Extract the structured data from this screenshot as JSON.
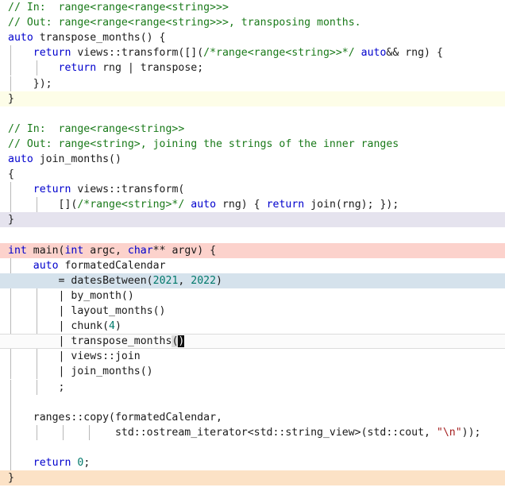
{
  "editor": {
    "language": "cpp",
    "total_lines": 32,
    "colors": {
      "background": "#ffffff",
      "default_text": "#1a1a1a",
      "comment": "#1a7a1a",
      "keyword": "#0000cd",
      "number": "#00796b",
      "string": "#a52020",
      "indent_guide": "#b8b8b8",
      "highlight_yellow": "#fdfde8",
      "highlight_lavender": "#e5e3ee",
      "highlight_pink": "#fcd2cc",
      "highlight_blue": "#d5e2ec",
      "highlight_peach": "#fce2c6",
      "cursor_line": "#fbfbfb",
      "bracket_match": "#dcdcdc",
      "block_cursor": "#101010"
    },
    "cursor": {
      "line_index": 23,
      "column": 27,
      "character": ")",
      "matching_bracket_character": "("
    },
    "lines": [
      {
        "index": 0,
        "highlight": "none",
        "indent_guides": 0,
        "plain": "// In:  range<range<range<string>>>",
        "tokens": [
          {
            "t": "comment",
            "s": "// In:  range<range<range<string>>>"
          }
        ]
      },
      {
        "index": 1,
        "highlight": "none",
        "indent_guides": 0,
        "plain": "// Out: range<range<range<string>>>, transposing months.",
        "tokens": [
          {
            "t": "comment",
            "s": "// Out: range<range<range<string>>>, transposing months."
          }
        ]
      },
      {
        "index": 2,
        "highlight": "none",
        "indent_guides": 0,
        "plain": "auto transpose_months() {",
        "tokens": [
          {
            "t": "keyword",
            "s": "auto"
          },
          {
            "t": "plain",
            "s": " transpose_months() {"
          }
        ]
      },
      {
        "index": 3,
        "highlight": "none",
        "indent_guides": 1,
        "plain": "    return views::transform([](/*range<range<string>>*/ auto&& rng) {",
        "tokens": [
          {
            "t": "plain",
            "s": "    "
          },
          {
            "t": "keyword",
            "s": "return"
          },
          {
            "t": "plain",
            "s": " views::transform([]("
          },
          {
            "t": "comment",
            "s": "/*range<range<string>>*/"
          },
          {
            "t": "plain",
            "s": " "
          },
          {
            "t": "keyword",
            "s": "auto"
          },
          {
            "t": "plain",
            "s": "&& rng) {"
          }
        ]
      },
      {
        "index": 4,
        "highlight": "none",
        "indent_guides": 2,
        "plain": "        return rng | transpose;",
        "tokens": [
          {
            "t": "plain",
            "s": "        "
          },
          {
            "t": "keyword",
            "s": "return"
          },
          {
            "t": "plain",
            "s": " rng | transpose;"
          }
        ]
      },
      {
        "index": 5,
        "highlight": "none",
        "indent_guides": 1,
        "plain": "    });",
        "tokens": [
          {
            "t": "plain",
            "s": "    });"
          }
        ]
      },
      {
        "index": 6,
        "highlight": "yellow",
        "indent_guides": 0,
        "plain": "}",
        "tokens": [
          {
            "t": "plain",
            "s": "}"
          }
        ]
      },
      {
        "index": 7,
        "highlight": "none",
        "indent_guides": 0,
        "plain": "",
        "tokens": []
      },
      {
        "index": 8,
        "highlight": "none",
        "indent_guides": 0,
        "plain": "// In:  range<range<string>>",
        "tokens": [
          {
            "t": "comment",
            "s": "// In:  range<range<string>>"
          }
        ]
      },
      {
        "index": 9,
        "highlight": "none",
        "indent_guides": 0,
        "plain": "// Out: range<string>, joining the strings of the inner ranges",
        "tokens": [
          {
            "t": "comment",
            "s": "// Out: range<string>, joining the strings of the inner ranges"
          }
        ]
      },
      {
        "index": 10,
        "highlight": "none",
        "indent_guides": 0,
        "plain": "auto join_months()",
        "tokens": [
          {
            "t": "keyword",
            "s": "auto"
          },
          {
            "t": "plain",
            "s": " join_months()"
          }
        ]
      },
      {
        "index": 11,
        "highlight": "none",
        "indent_guides": 0,
        "plain": "{",
        "tokens": [
          {
            "t": "plain",
            "s": "{"
          }
        ]
      },
      {
        "index": 12,
        "highlight": "none",
        "indent_guides": 1,
        "plain": "    return views::transform(",
        "tokens": [
          {
            "t": "plain",
            "s": "    "
          },
          {
            "t": "keyword",
            "s": "return"
          },
          {
            "t": "plain",
            "s": " views::transform("
          }
        ]
      },
      {
        "index": 13,
        "highlight": "none",
        "indent_guides": 2,
        "plain": "        [](/*range<string>*/ auto rng) { return join(rng); });",
        "tokens": [
          {
            "t": "plain",
            "s": "        []("
          },
          {
            "t": "comment",
            "s": "/*range<string>*/"
          },
          {
            "t": "plain",
            "s": " "
          },
          {
            "t": "keyword",
            "s": "auto"
          },
          {
            "t": "plain",
            "s": " rng) { "
          },
          {
            "t": "keyword",
            "s": "return"
          },
          {
            "t": "plain",
            "s": " join(rng); });"
          }
        ]
      },
      {
        "index": 14,
        "highlight": "lavender",
        "indent_guides": 0,
        "plain": "}",
        "tokens": [
          {
            "t": "plain",
            "s": "}"
          }
        ]
      },
      {
        "index": 15,
        "highlight": "none",
        "indent_guides": 0,
        "plain": "",
        "tokens": []
      },
      {
        "index": 16,
        "highlight": "pink",
        "indent_guides": 0,
        "plain": "int main(int argc, char** argv) {",
        "tokens": [
          {
            "t": "keyword",
            "s": "int"
          },
          {
            "t": "plain",
            "s": " main("
          },
          {
            "t": "keyword",
            "s": "int"
          },
          {
            "t": "plain",
            "s": " argc, "
          },
          {
            "t": "keyword",
            "s": "char"
          },
          {
            "t": "plain",
            "s": "** argv) {"
          }
        ]
      },
      {
        "index": 17,
        "highlight": "none",
        "indent_guides": 1,
        "plain": "    auto formatedCalendar",
        "tokens": [
          {
            "t": "plain",
            "s": "    "
          },
          {
            "t": "keyword",
            "s": "auto"
          },
          {
            "t": "plain",
            "s": " formatedCalendar"
          }
        ]
      },
      {
        "index": 18,
        "highlight": "blue",
        "indent_guides": 2,
        "plain": "        = datesBetween(2021, 2022)",
        "tokens": [
          {
            "t": "plain",
            "s": "        = datesBetween("
          },
          {
            "t": "number",
            "s": "2021"
          },
          {
            "t": "plain",
            "s": ", "
          },
          {
            "t": "number",
            "s": "2022"
          },
          {
            "t": "plain",
            "s": ")"
          }
        ]
      },
      {
        "index": 19,
        "highlight": "none",
        "indent_guides": 2,
        "plain": "        | by_month()",
        "tokens": [
          {
            "t": "plain",
            "s": "        | by_month()"
          }
        ]
      },
      {
        "index": 20,
        "highlight": "none",
        "indent_guides": 2,
        "plain": "        | layout_months()",
        "tokens": [
          {
            "t": "plain",
            "s": "        | layout_months()"
          }
        ]
      },
      {
        "index": 21,
        "highlight": "none",
        "indent_guides": 2,
        "plain": "        | chunk(4)",
        "tokens": [
          {
            "t": "plain",
            "s": "        | chunk("
          },
          {
            "t": "number",
            "s": "4"
          },
          {
            "t": "plain",
            "s": ")"
          }
        ]
      },
      {
        "index": 22,
        "highlight": "cursor",
        "indent_guides": 2,
        "plain": "        | transpose_months()",
        "tokens": [
          {
            "t": "plain",
            "s": "        | transpose_months"
          },
          {
            "t": "bracket-match",
            "s": "("
          },
          {
            "t": "block-cursor",
            "s": ")"
          }
        ]
      },
      {
        "index": 23,
        "highlight": "none",
        "indent_guides": 2,
        "plain": "        | views::join",
        "tokens": [
          {
            "t": "plain",
            "s": "        | views::join"
          }
        ]
      },
      {
        "index": 24,
        "highlight": "none",
        "indent_guides": 2,
        "plain": "        | join_months()",
        "tokens": [
          {
            "t": "plain",
            "s": "        | join_months()"
          }
        ]
      },
      {
        "index": 25,
        "highlight": "none",
        "indent_guides": 2,
        "plain": "        ;",
        "tokens": [
          {
            "t": "plain",
            "s": "        ;"
          }
        ]
      },
      {
        "index": 26,
        "highlight": "none",
        "indent_guides": 1,
        "plain": "",
        "tokens": []
      },
      {
        "index": 27,
        "highlight": "none",
        "indent_guides": 1,
        "plain": "    ranges::copy(formatedCalendar,",
        "tokens": [
          {
            "t": "plain",
            "s": "    ranges::copy(formatedCalendar,"
          }
        ]
      },
      {
        "index": 28,
        "highlight": "none",
        "indent_guides": 4,
        "plain": "                 std::ostream_iterator<std::string_view>(std::cout, \"\\n\"));",
        "tokens": [
          {
            "t": "plain",
            "s": "                 std::ostream_iterator<std::string_view>(std::cout, "
          },
          {
            "t": "string",
            "s": "\"\\n\""
          },
          {
            "t": "plain",
            "s": "));"
          }
        ]
      },
      {
        "index": 29,
        "highlight": "none",
        "indent_guides": 1,
        "plain": "",
        "tokens": []
      },
      {
        "index": 30,
        "highlight": "none",
        "indent_guides": 1,
        "plain": "    return 0;",
        "tokens": [
          {
            "t": "plain",
            "s": "    "
          },
          {
            "t": "keyword",
            "s": "return"
          },
          {
            "t": "plain",
            "s": " "
          },
          {
            "t": "number",
            "s": "0"
          },
          {
            "t": "plain",
            "s": ";"
          }
        ]
      },
      {
        "index": 31,
        "highlight": "peach",
        "indent_guides": 0,
        "plain": "}",
        "tokens": [
          {
            "t": "plain",
            "s": "}"
          }
        ]
      }
    ]
  }
}
